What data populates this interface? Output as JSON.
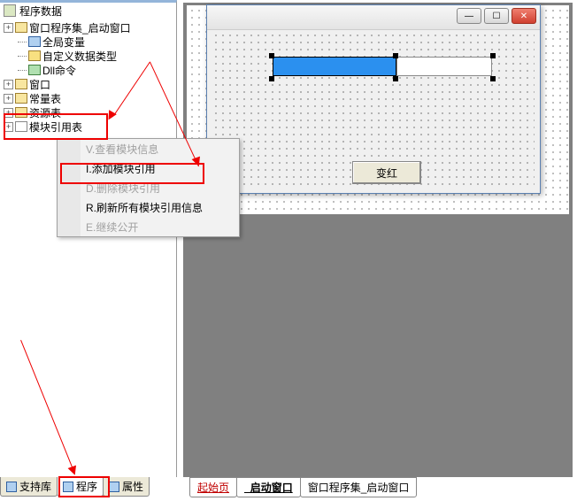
{
  "tree": {
    "header": "程序数据",
    "nodes": [
      {
        "toggle": "+",
        "icon": "ic-folder",
        "label": "窗口程序集_启动窗口",
        "indent": 0
      },
      {
        "toggle": "",
        "icon": "ic-blue",
        "label": "全局变量",
        "indent": 1
      },
      {
        "toggle": "",
        "icon": "ic-yellow",
        "label": "自定义数据类型",
        "indent": 1
      },
      {
        "toggle": "",
        "icon": "ic-green",
        "label": "Dll命令",
        "indent": 1
      },
      {
        "toggle": "+",
        "icon": "ic-folder",
        "label": "窗口",
        "indent": 0
      },
      {
        "toggle": "+",
        "icon": "ic-folder",
        "label": "常量表",
        "indent": 0
      },
      {
        "toggle": "+",
        "icon": "ic-folder",
        "label": "资源表",
        "indent": 0
      },
      {
        "toggle": "+",
        "icon": "ic-white",
        "label": "模块引用表",
        "indent": 0
      }
    ]
  },
  "context_menu": {
    "items": [
      {
        "label": "V.查看模块信息",
        "disabled": true
      },
      {
        "label": "I.添加模块引用",
        "disabled": false
      },
      {
        "label": "D.删除模块引用",
        "disabled": true
      },
      {
        "label": "R.刷新所有模块引用信息",
        "disabled": false
      },
      {
        "label": "E.继续公开",
        "disabled": true
      }
    ]
  },
  "left_tabs": [
    {
      "label": "支持库",
      "active": false
    },
    {
      "label": "程序",
      "active": true
    },
    {
      "label": "属性",
      "active": false
    }
  ],
  "right_tabs": [
    {
      "label": "起始页",
      "kind": "start"
    },
    {
      "label": "_启动窗口",
      "kind": "active"
    },
    {
      "label": "窗口程序集_启动窗口",
      "kind": "normal"
    }
  ],
  "form": {
    "button_label": "变红"
  },
  "win_btns": {
    "min": "—",
    "max": "☐",
    "close": "✕"
  }
}
